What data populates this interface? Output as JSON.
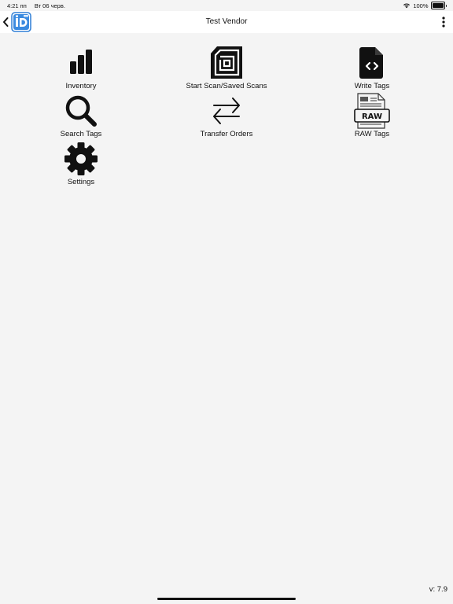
{
  "status_bar": {
    "time": "4:21 пп",
    "date": "Вт 06 черв.",
    "battery_percent": "100%",
    "battery_level": 1.0
  },
  "nav": {
    "title": "Test Vendor",
    "logo_text": "iD"
  },
  "menu": {
    "inventory": "Inventory",
    "start_scan": "Start Scan/Saved Scans",
    "write_tags": "Write Tags",
    "search_tags": "Search Tags",
    "transfer_orders": "Transfer Orders",
    "raw_tags": "RAW Tags",
    "raw_badge": "RAW",
    "settings": "Settings"
  },
  "footer": {
    "version": "v: 7.9"
  },
  "colors": {
    "background": "#f4f4f4",
    "nav_background": "#ffffff",
    "logo_blue": "#2f7fd6"
  }
}
